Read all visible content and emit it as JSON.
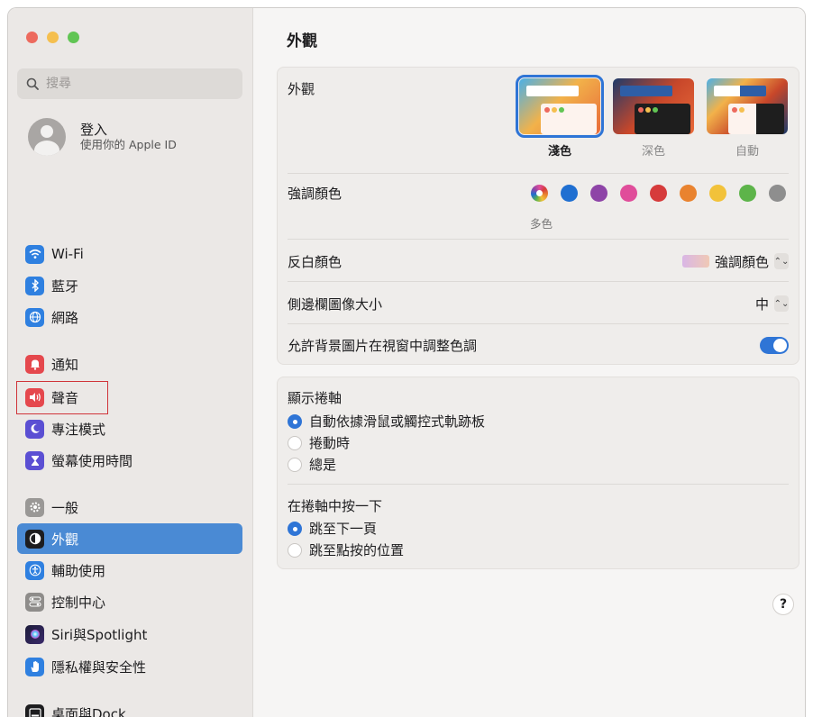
{
  "colors": {
    "accent": "#2f75d6",
    "selection": "#4a8ad4"
  },
  "search": {
    "placeholder": "搜尋"
  },
  "account": {
    "title": "登入",
    "subtitle": "使用你的 Apple ID"
  },
  "sidebar": {
    "items": [
      {
        "label": "Wi-Fi",
        "icon": "wifi-icon"
      },
      {
        "label": "藍牙",
        "icon": "bluetooth-icon"
      },
      {
        "label": "網路",
        "icon": "globe-icon"
      },
      {
        "label": "通知",
        "icon": "bell-icon"
      },
      {
        "label": "聲音",
        "icon": "speaker-icon"
      },
      {
        "label": "專注模式",
        "icon": "moon-icon"
      },
      {
        "label": "螢幕使用時間",
        "icon": "hourglass-icon"
      },
      {
        "label": "一般",
        "icon": "gear-icon"
      },
      {
        "label": "外觀",
        "icon": "appearance-icon",
        "selected": true
      },
      {
        "label": "輔助使用",
        "icon": "accessibility-icon"
      },
      {
        "label": "控制中心",
        "icon": "control-center-icon"
      },
      {
        "label": "Siri與Spotlight",
        "icon": "siri-icon"
      },
      {
        "label": "隱私權與安全性",
        "icon": "hand-icon"
      },
      {
        "label": "桌面與Dock",
        "icon": "dock-icon"
      }
    ]
  },
  "main": {
    "title": "外觀",
    "appearance_label": "外觀",
    "appearance_options": [
      {
        "label": "淺色",
        "selected": true
      },
      {
        "label": "深色",
        "selected": false
      },
      {
        "label": "自動",
        "selected": false
      }
    ],
    "accent_label": "強調顏色",
    "accent_multi_label": "多色",
    "accent_colors": [
      "#1f6fd1",
      "#8e44a7",
      "#e04d9a",
      "#d63b3b",
      "#e9832f",
      "#f2c23a",
      "#5db44a",
      "#8e8e8e"
    ],
    "highlight_label": "反白顏色",
    "highlight_value": "強調顏色",
    "sidebar_size_label": "側邊欄圖像大小",
    "sidebar_size_value": "中",
    "wallpaper_tint_label": "允許背景圖片在視窗中調整色調",
    "wallpaper_tint_on": true,
    "scrollbars_title": "顯示捲軸",
    "scrollbar_options": [
      {
        "label": "自動依據滑鼠或觸控式軌跡板",
        "selected": true
      },
      {
        "label": "捲動時",
        "selected": false
      },
      {
        "label": "總是",
        "selected": false
      }
    ],
    "click_title": "在捲軸中按一下",
    "click_options": [
      {
        "label": "跳至下一頁",
        "selected": true
      },
      {
        "label": "跳至點按的位置",
        "selected": false
      }
    ],
    "help_label": "?"
  }
}
